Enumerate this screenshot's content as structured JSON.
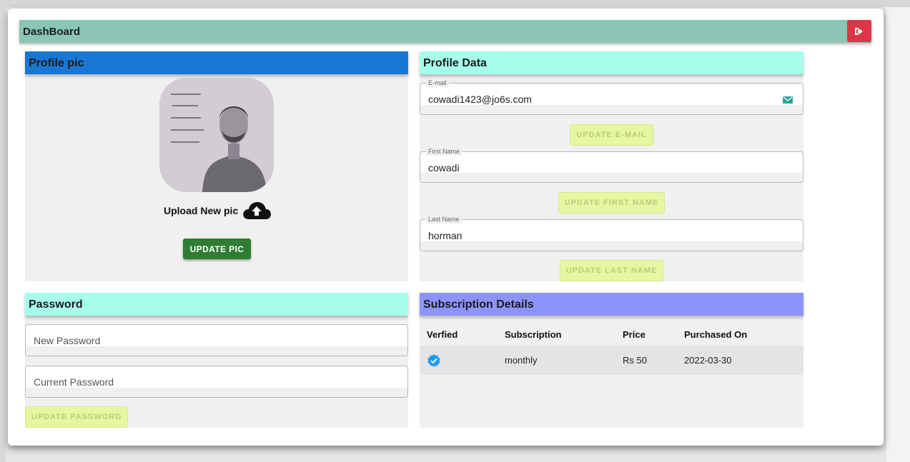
{
  "header": {
    "title": "DashBoard",
    "logout_icon": "sign-out-icon"
  },
  "profile_pic": {
    "title": "Profile pic",
    "upload_label": "Upload New pic",
    "upload_icon": "cloud-upload-icon",
    "update_button": "UPDATE PIC"
  },
  "profile_data": {
    "title": "Profile Data",
    "email": {
      "label": "E-mail",
      "value": "cowadi1423@jo6s.com",
      "icon": "mail-icon",
      "button": "UPDATE E-MAIL"
    },
    "first_name": {
      "label": "First Name",
      "value": "cowadi",
      "button": "UPDATE FIRST NAME"
    },
    "last_name": {
      "label": "Last Name",
      "value": "horman",
      "button": "UPDATE LAST NAME"
    }
  },
  "password": {
    "title": "Password",
    "new_placeholder": "New Password",
    "current_placeholder": "Current Password",
    "button": "UPDATE PASSWORD"
  },
  "subscription": {
    "title": "Subscription Details",
    "columns": [
      "Verfied",
      "Subscription",
      "Price",
      "Purchased On"
    ],
    "rows": [
      {
        "verified_icon": "verified-badge-icon",
        "subscription": "monthly",
        "price": "Rs 50",
        "purchased_on": "2022-03-30"
      }
    ]
  },
  "colors": {
    "header_bg": "#8ac5b5",
    "profile_pic_head": "#1976d2",
    "profile_data_head": "#a7ffeb",
    "password_head": "#a7ffeb",
    "subscription_head": "#8c94fa",
    "logout": "#dc3545",
    "update_pic": "#2e7d32"
  }
}
